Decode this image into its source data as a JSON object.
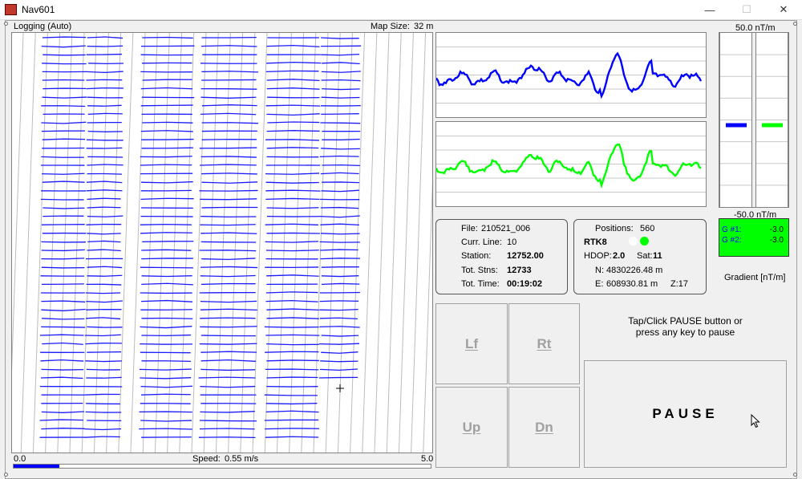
{
  "window": {
    "title": "Nav601",
    "minimize": "—",
    "maximize": "☐",
    "close": "✕"
  },
  "map": {
    "mode_label": "Logging (Auto)",
    "map_size_label": "Map Size:",
    "map_size_value": "32 m"
  },
  "speed": {
    "min": "0.0",
    "max": "5.0",
    "label": "Speed:",
    "value": "0.55 m/s",
    "level": 0.11
  },
  "gradient": {
    "max_label": "50.0 nT/m",
    "min_label": "-50.0 nT/m",
    "g1_label": "G #1:",
    "g1_value": "-3.0",
    "g2_label": "G #2:",
    "g2_value": "-3.0",
    "units_label": "Gradient [nT/m]",
    "colors": {
      "g1": "#0000ff",
      "g2": "#00ff00",
      "readout_bg": "#00ff00"
    }
  },
  "file_info": {
    "file_label": "File:",
    "file_value": "210521_006",
    "line_label": "Curr. Line:",
    "line_value": "10",
    "station_label": "Station:",
    "station_value": "12752.00",
    "tot_stns_label": "Tot. Stns:",
    "tot_stns_value": "12733",
    "tot_time_label": "Tot. Time:",
    "tot_time_value": "00:19:02"
  },
  "gps": {
    "positions_label": "Positions:",
    "positions_value": "560",
    "rtk_label": "RTK8",
    "hdop_label": "HDOP:",
    "hdop_value": "2.0",
    "sat_label": "Sat:",
    "sat_value": "11",
    "north_label": "N:",
    "north_value": "4830226.48 m",
    "east_label": "E:",
    "east_value": "608930.81 m",
    "zone_label": "Z:17"
  },
  "buttons": {
    "left": "Lf",
    "right": "Rt",
    "up": "Up",
    "down": "Dn",
    "pause": "PAUSE"
  },
  "pause_hint": {
    "line1": "Tap/Click PAUSE button or",
    "line2": "press any key to pause"
  }
}
